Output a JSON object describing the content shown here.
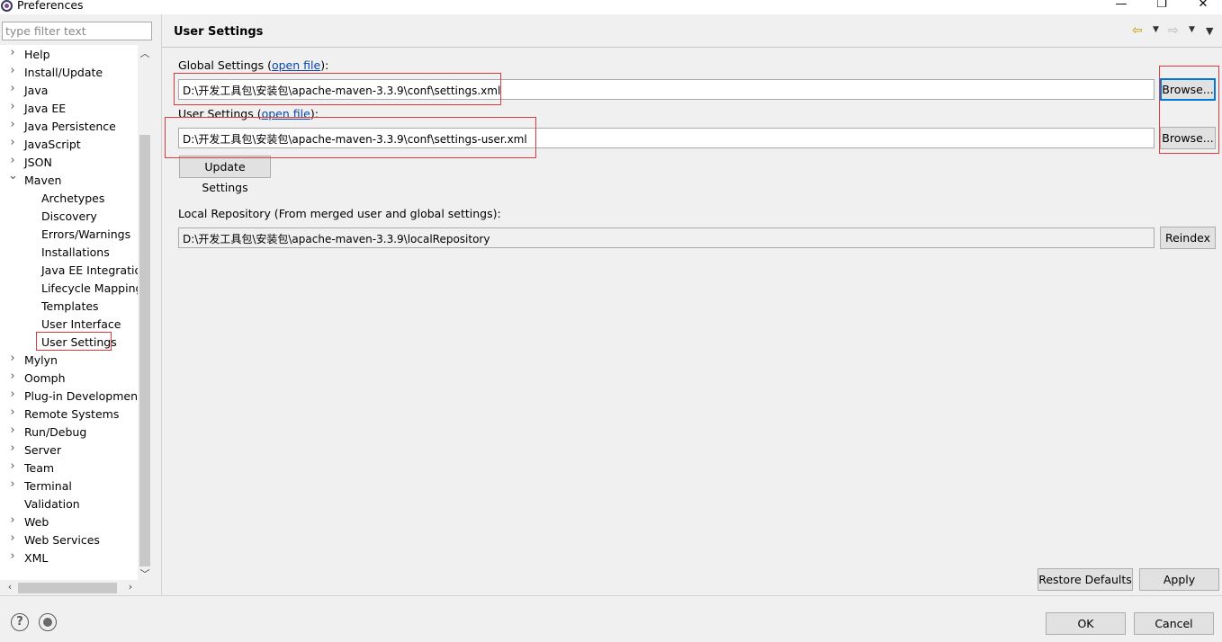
{
  "window": {
    "title": "Preferences",
    "minimize": "—",
    "restore": "❐",
    "close": "✕"
  },
  "sidebar": {
    "filter_placeholder": "type filter text",
    "items": [
      {
        "label": "Help",
        "level": 0,
        "expandable": true
      },
      {
        "label": "Install/Update",
        "level": 0,
        "expandable": true
      },
      {
        "label": "Java",
        "level": 0,
        "expandable": true
      },
      {
        "label": "Java EE",
        "level": 0,
        "expandable": true
      },
      {
        "label": "Java Persistence",
        "level": 0,
        "expandable": true
      },
      {
        "label": "JavaScript",
        "level": 0,
        "expandable": true
      },
      {
        "label": "JSON",
        "level": 0,
        "expandable": true
      },
      {
        "label": "Maven",
        "level": 0,
        "expandable": true,
        "expanded": true
      },
      {
        "label": "Archetypes",
        "level": 1
      },
      {
        "label": "Discovery",
        "level": 1
      },
      {
        "label": "Errors/Warnings",
        "level": 1
      },
      {
        "label": "Installations",
        "level": 1
      },
      {
        "label": "Java EE Integration",
        "level": 1
      },
      {
        "label": "Lifecycle Mapping",
        "level": 1
      },
      {
        "label": "Templates",
        "level": 1
      },
      {
        "label": "User Interface",
        "level": 1
      },
      {
        "label": "User Settings",
        "level": 1,
        "selected": true
      },
      {
        "label": "Mylyn",
        "level": 0,
        "expandable": true
      },
      {
        "label": "Oomph",
        "level": 0,
        "expandable": true
      },
      {
        "label": "Plug-in Development",
        "level": 0,
        "expandable": true
      },
      {
        "label": "Remote Systems",
        "level": 0,
        "expandable": true
      },
      {
        "label": "Run/Debug",
        "level": 0,
        "expandable": true
      },
      {
        "label": "Server",
        "level": 0,
        "expandable": true
      },
      {
        "label": "Team",
        "level": 0,
        "expandable": true
      },
      {
        "label": "Terminal",
        "level": 0,
        "expandable": true
      },
      {
        "label": "Validation",
        "level": 0,
        "expandable": false
      },
      {
        "label": "Web",
        "level": 0,
        "expandable": true
      },
      {
        "label": "Web Services",
        "level": 0,
        "expandable": true
      },
      {
        "label": "XML",
        "level": 0,
        "expandable": true
      }
    ]
  },
  "main": {
    "title": "User Settings",
    "global": {
      "label_prefix": "Global Settings (",
      "link": "open file",
      "label_suffix": "):",
      "path": "D:\\开发工具包\\安装包\\apache-maven-3.3.9\\conf\\settings.xml",
      "browse": "Browse..."
    },
    "user": {
      "label_prefix": "User Settings (",
      "link": "open file",
      "label_suffix": "):",
      "path": "D:\\开发工具包\\安装包\\apache-maven-3.3.9\\conf\\settings-user.xml",
      "browse": "Browse..."
    },
    "update_button": "Update Settings",
    "local_repo": {
      "label": "Local Repository (From merged user and global settings):",
      "path": "D:\\开发工具包\\安装包\\apache-maven-3.3.9\\localRepository",
      "reindex": "Reindex"
    },
    "restore_defaults": "Restore Defaults",
    "apply": "Apply"
  },
  "footer": {
    "ok": "OK",
    "cancel": "Cancel",
    "help_icon": "?"
  },
  "colors": {
    "highlight_box": "#e0393e",
    "link": "#0645ad",
    "focus": "#0078d7"
  }
}
